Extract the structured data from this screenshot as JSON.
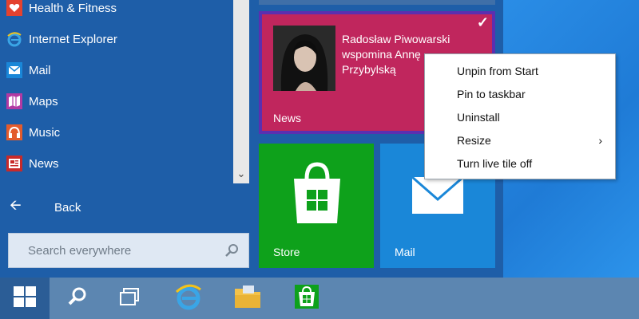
{
  "apps": [
    {
      "label": "Health & Fitness",
      "icon": "heart-icon",
      "color": "#e3422f"
    },
    {
      "label": "Internet Explorer",
      "icon": "internet-explorer-icon",
      "color": "#3aa5e6"
    },
    {
      "label": "Mail",
      "icon": "envelope-icon",
      "color": "#1a87d8"
    },
    {
      "label": "Maps",
      "icon": "maps-icon",
      "color": "#b23aa3"
    },
    {
      "label": "Music",
      "icon": "headphones-icon",
      "color": "#e35b2c"
    },
    {
      "label": "News",
      "icon": "newspaper-icon",
      "color": "#c72a2a"
    }
  ],
  "back_label": "Back",
  "search": {
    "placeholder": "Search everywhere"
  },
  "tiles": {
    "news": {
      "label": "News",
      "headline": "Radosław Piwowarski wspomina Annę Przybylską"
    },
    "store": {
      "label": "Store"
    },
    "mail": {
      "label": "Mail"
    }
  },
  "context_menu": {
    "items": [
      "Unpin from Start",
      "Pin to taskbar",
      "Uninstall",
      "Resize",
      "Turn live tile off"
    ]
  },
  "taskbar": {
    "icons": [
      "windows-logo-icon",
      "search-icon",
      "task-view-icon",
      "internet-explorer-icon",
      "file-explorer-icon",
      "store-icon"
    ]
  }
}
